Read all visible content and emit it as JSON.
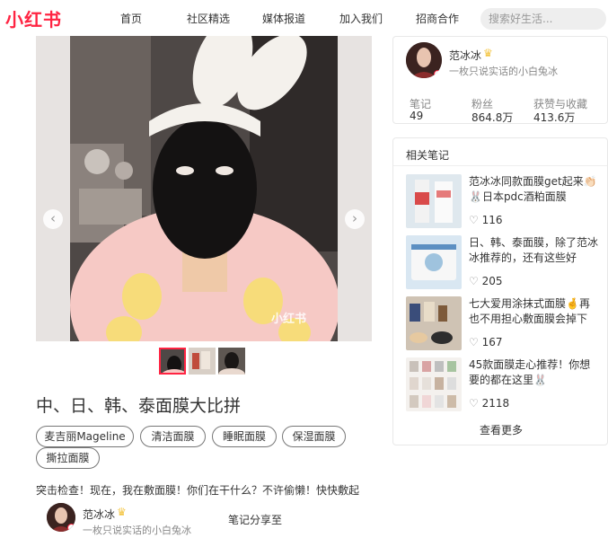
{
  "brand": {
    "logo": "小红书",
    "color": "#ff2442"
  },
  "nav": [
    "首页",
    "社区精选",
    "媒体报道",
    "加入我们",
    "招商合作"
  ],
  "search": {
    "placeholder": "搜索好生活..."
  },
  "photo": {
    "watermark": "小红书",
    "prev_icon": "chevron-left-icon",
    "next_icon": "chevron-right-icon"
  },
  "note": {
    "title": "中、日、韩、泰面膜大比拼",
    "tags": [
      "麦吉丽Mageline",
      "清洁面膜",
      "睡眠面膜",
      "保湿面膜",
      "撕拉面膜"
    ],
    "body": "突击检查！现在，我在敷面膜！你们在干什么？不许偷懒！快快敷起"
  },
  "author": {
    "name": "范冰冰",
    "bio": "一枚只说实话的小白兔冰",
    "share_label": "笔记分享至",
    "stats": [
      {
        "label": "笔记",
        "value": "49"
      },
      {
        "label": "粉丝",
        "value": "864.8万"
      },
      {
        "label": "获赞与收藏",
        "value": "413.6万"
      }
    ]
  },
  "related": {
    "heading": "相关笔记",
    "items": [
      {
        "text": "范冰冰同款面膜get起来👏🏻🐰日本pdc酒粕面膜",
        "likes": "116"
      },
      {
        "text": "日、韩、泰面膜，除了范冰冰推荐的，还有这些好",
        "likes": "205"
      },
      {
        "text": "七大爱用涂抹式面膜🤞再也不用担心敷面膜会掉下",
        "likes": "167"
      },
      {
        "text": "45款面膜走心推荐！你想要的都在这里🐰",
        "likes": "2118"
      }
    ],
    "see_more": "查看更多"
  }
}
